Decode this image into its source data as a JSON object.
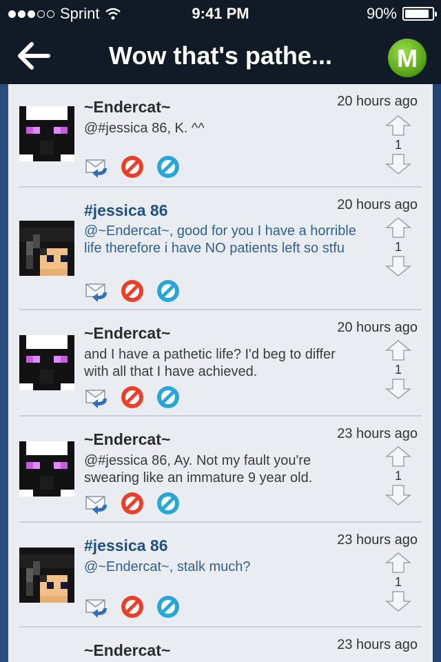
{
  "status_bar": {
    "carrier": "Sprint",
    "time": "9:41 PM",
    "battery_percent": "90%",
    "battery_level": 0.9
  },
  "nav": {
    "title": "Wow that's pathe...",
    "badge_letter": "M"
  },
  "comments": [
    {
      "author": "~Endercat~",
      "time": "20 hours ago",
      "text": "@#jessica 86, K. ^^",
      "votes": "1",
      "avatar": "enderman-avatar"
    },
    {
      "author": "#jessica 86",
      "time": "20 hours ago",
      "text": "@~Endercat~, good for you I have a horrible life therefore i have NO patients left so stfu",
      "votes": "1",
      "avatar": "pixel-girl-avatar"
    },
    {
      "author": "~Endercat~",
      "time": "20 hours ago",
      "text": "and I have a pathetic life? I'd beg to differ with all that I have achieved.",
      "votes": "1",
      "avatar": "enderman-avatar"
    },
    {
      "author": "~Endercat~",
      "time": "23 hours ago",
      "text": "@#jessica 86, Ay. Not my fault you're swearing like an immature 9 year old.",
      "votes": "1",
      "avatar": "enderman-avatar"
    },
    {
      "author": "#jessica 86",
      "time": "23 hours ago",
      "text": "@~Endercat~, stalk much?",
      "votes": "1",
      "avatar": "pixel-girl-avatar"
    },
    {
      "author": "~Endercat~",
      "time": "23 hours ago",
      "text": "",
      "votes": "",
      "avatar": "enderman-avatar"
    }
  ],
  "colors": {
    "nav_bg": "#111b27",
    "sheet_bg": "#e9edf1",
    "author_blue": "#1f4f83",
    "text_blue": "#2f5f92",
    "badge_green": "#6cc21e",
    "block_red": "#e8402a",
    "flag_blue": "#2aa5d8"
  }
}
